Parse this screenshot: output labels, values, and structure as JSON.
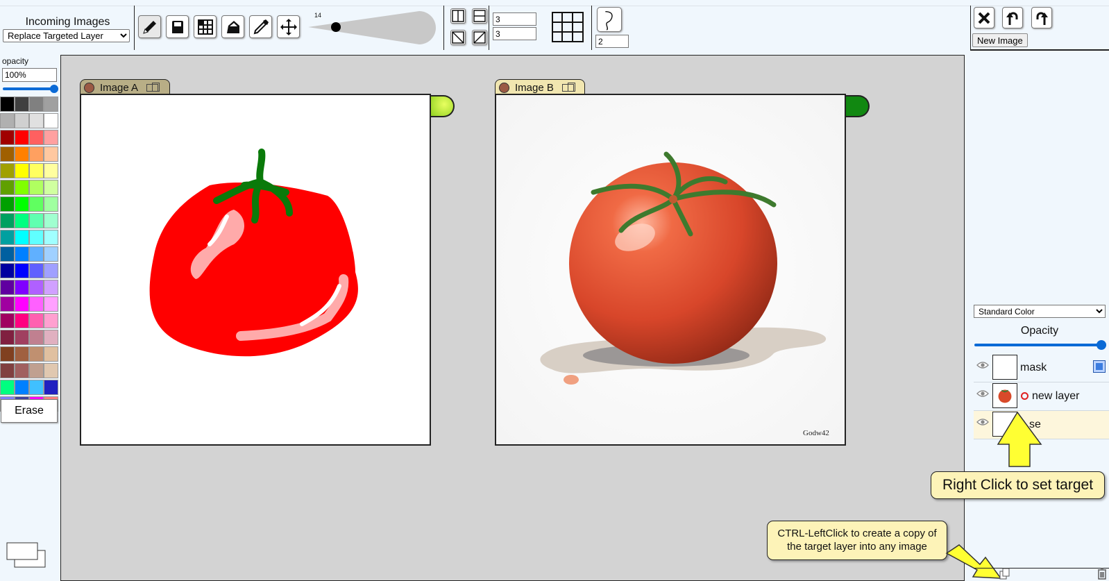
{
  "toolbar": {
    "incoming_title": "Incoming Images",
    "incoming_mode": "Replace Targeted Layer",
    "tools": [
      {
        "name": "pencil-icon",
        "active": true
      },
      {
        "name": "eraser-icon"
      },
      {
        "name": "grid-select-icon"
      },
      {
        "name": "fill-bucket-icon"
      },
      {
        "name": "eyedropper-icon"
      },
      {
        "name": "move-icon"
      }
    ],
    "brush_size": "14",
    "brush_size_fraction": 0.2,
    "grid_cols": "3",
    "grid_rows": "3",
    "smoothing": "2"
  },
  "actions": {
    "close_icon": "close-icon",
    "undo_icon": "undo-icon",
    "redo_icon": "redo-icon",
    "new_image_label": "New Image"
  },
  "palette": {
    "opacity_label": "opacity",
    "opacity_value": "100%",
    "opacity_fraction": 1.0,
    "erase_label": "Erase",
    "rows": [
      [
        "#000000",
        "#404040",
        "#808080",
        "#a0a0a0"
      ],
      [
        "#b0b0b0",
        "#d0d0d0",
        "#e0e0e0",
        "#ffffff"
      ],
      [
        "#a00000",
        "#ff0000",
        "#ff6060",
        "#ffa0a0"
      ],
      [
        "#a06000",
        "#ff8000",
        "#ffa060",
        "#ffc8a0"
      ],
      [
        "#a0a000",
        "#ffff00",
        "#ffff60",
        "#ffffa0"
      ],
      [
        "#60a000",
        "#80ff00",
        "#b0ff60",
        "#d0ffa0"
      ],
      [
        "#00a000",
        "#00ff00",
        "#60ff60",
        "#a0ffa0"
      ],
      [
        "#00a060",
        "#00ff80",
        "#60ffb0",
        "#a0ffd0"
      ],
      [
        "#00a0a0",
        "#00ffff",
        "#60ffff",
        "#a0ffff"
      ],
      [
        "#0060a0",
        "#0080ff",
        "#60b0ff",
        "#a0d0ff"
      ],
      [
        "#0000a0",
        "#0000ff",
        "#6060ff",
        "#a0a0ff"
      ],
      [
        "#6000a0",
        "#8000ff",
        "#b060ff",
        "#d0a0ff"
      ],
      [
        "#a000a0",
        "#ff00ff",
        "#ff60ff",
        "#ffa0ff"
      ],
      [
        "#a00060",
        "#ff0080",
        "#ff60b0",
        "#ffa0d0"
      ],
      [
        "#802040",
        "#a04060",
        "#c08090",
        "#e0b0c0"
      ],
      [
        "#804020",
        "#a06040",
        "#c09070",
        "#e0c0a0"
      ],
      [
        "#804040",
        "#a06060",
        "#c0a090",
        "#e0c8b0"
      ],
      [
        "#00ff80",
        "#0080ff",
        "#40c0ff",
        "#2020c0"
      ],
      [
        "#8080ff",
        "#4040a0",
        "#ff00ff",
        "#ff8080"
      ]
    ]
  },
  "images": [
    {
      "title": "Image A",
      "knob_color": "#8fd020",
      "tab_color": "#b8ae86"
    },
    {
      "title": "Image B",
      "knob_color": "#118811",
      "tab_color": "#f1e6b0"
    }
  ],
  "layers_panel": {
    "blend_mode": "Standard Color",
    "opacity_label": "Opacity",
    "opacity_fraction": 1.0,
    "layers": [
      {
        "name": "mask"
      },
      {
        "name": "new layer"
      },
      {
        "name": "se"
      }
    ]
  },
  "callouts": {
    "right_click": "Right Click to set target",
    "ctrl_click_line1": "CTRL-LeftClick to create a copy of",
    "ctrl_click_line2": "the target layer into any image"
  },
  "signature": "Godw42"
}
